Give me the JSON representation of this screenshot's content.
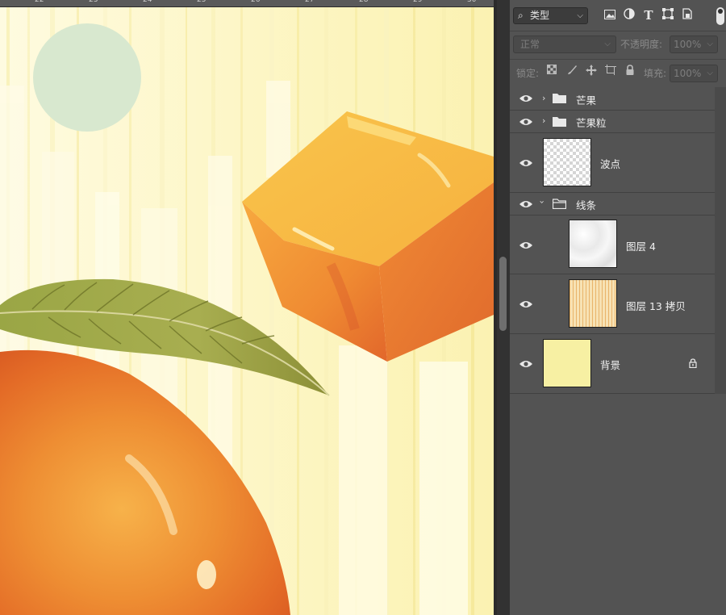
{
  "ruler": {
    "labels": [
      "22",
      "23",
      "24",
      "25",
      "26",
      "27",
      "28",
      "29",
      "30"
    ]
  },
  "layers_panel": {
    "filter": {
      "label": "类型"
    },
    "filter_icons": [
      "image-filter-icon",
      "adjustment-filter-icon",
      "text-filter-icon",
      "shape-filter-icon",
      "smart-object-filter-icon"
    ],
    "blend_mode": "正常",
    "opacity_label": "不透明度:",
    "opacity_value": "100%",
    "lock_label": "锁定:",
    "fill_label": "填充:",
    "fill_value": "100%",
    "layers": [
      {
        "name": "芒果",
        "type": "group",
        "expanded": false,
        "visible": true
      },
      {
        "name": "芒果粒",
        "type": "group",
        "expanded": false,
        "visible": true
      },
      {
        "name": "波点",
        "type": "layer",
        "thumbnail": "transparent",
        "visible": true
      },
      {
        "name": "线条",
        "type": "group",
        "expanded": true,
        "visible": true
      },
      {
        "name": "图层 4",
        "type": "layer",
        "thumbnail": "marble-texture",
        "indented": true,
        "visible": true
      },
      {
        "name": "图层 13 拷贝",
        "type": "layer",
        "thumbnail": "vertical-stripes",
        "indented": true,
        "visible": true
      },
      {
        "name": "背景",
        "type": "background",
        "thumbnail": "pale-yellow",
        "locked": true,
        "visible": true
      }
    ]
  },
  "colors": {
    "panel_bg": "#535353",
    "background_layer_fill": "#f7f0a3",
    "canvas_bg": "#fdf8cf",
    "circle": "#d8e8cf",
    "mango": "#e8742a",
    "cube": "#f0a23a",
    "leaf": "#8e9a3a"
  }
}
